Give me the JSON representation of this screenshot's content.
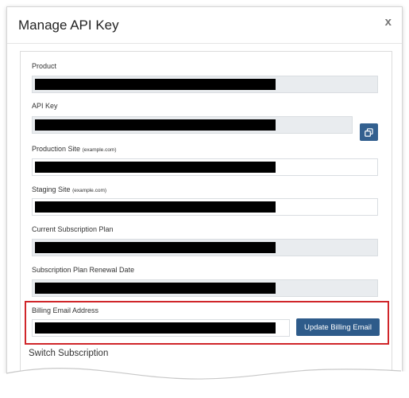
{
  "modal": {
    "title": "Manage API Key",
    "close_label": "x"
  },
  "fields": {
    "product": {
      "label": "Product"
    },
    "api_key": {
      "label": "API Key"
    },
    "production_site": {
      "label": "Production Site",
      "hint": "(example.com)"
    },
    "staging_site": {
      "label": "Staging Site",
      "hint": "(example.com)"
    },
    "current_plan": {
      "label": "Current Subscription Plan"
    },
    "renewal_date": {
      "label": "Subscription Plan Renewal Date"
    },
    "billing_email": {
      "label": "Billing Email Address"
    }
  },
  "buttons": {
    "copy_icon": "copy-icon",
    "update_billing": "Update Billing Email"
  },
  "sections": {
    "switch_subscription": "Switch Subscription"
  },
  "colors": {
    "primary_button": "#2e5b8a",
    "highlight_border": "#d0262a",
    "readonly_field": "#e9ecef"
  }
}
